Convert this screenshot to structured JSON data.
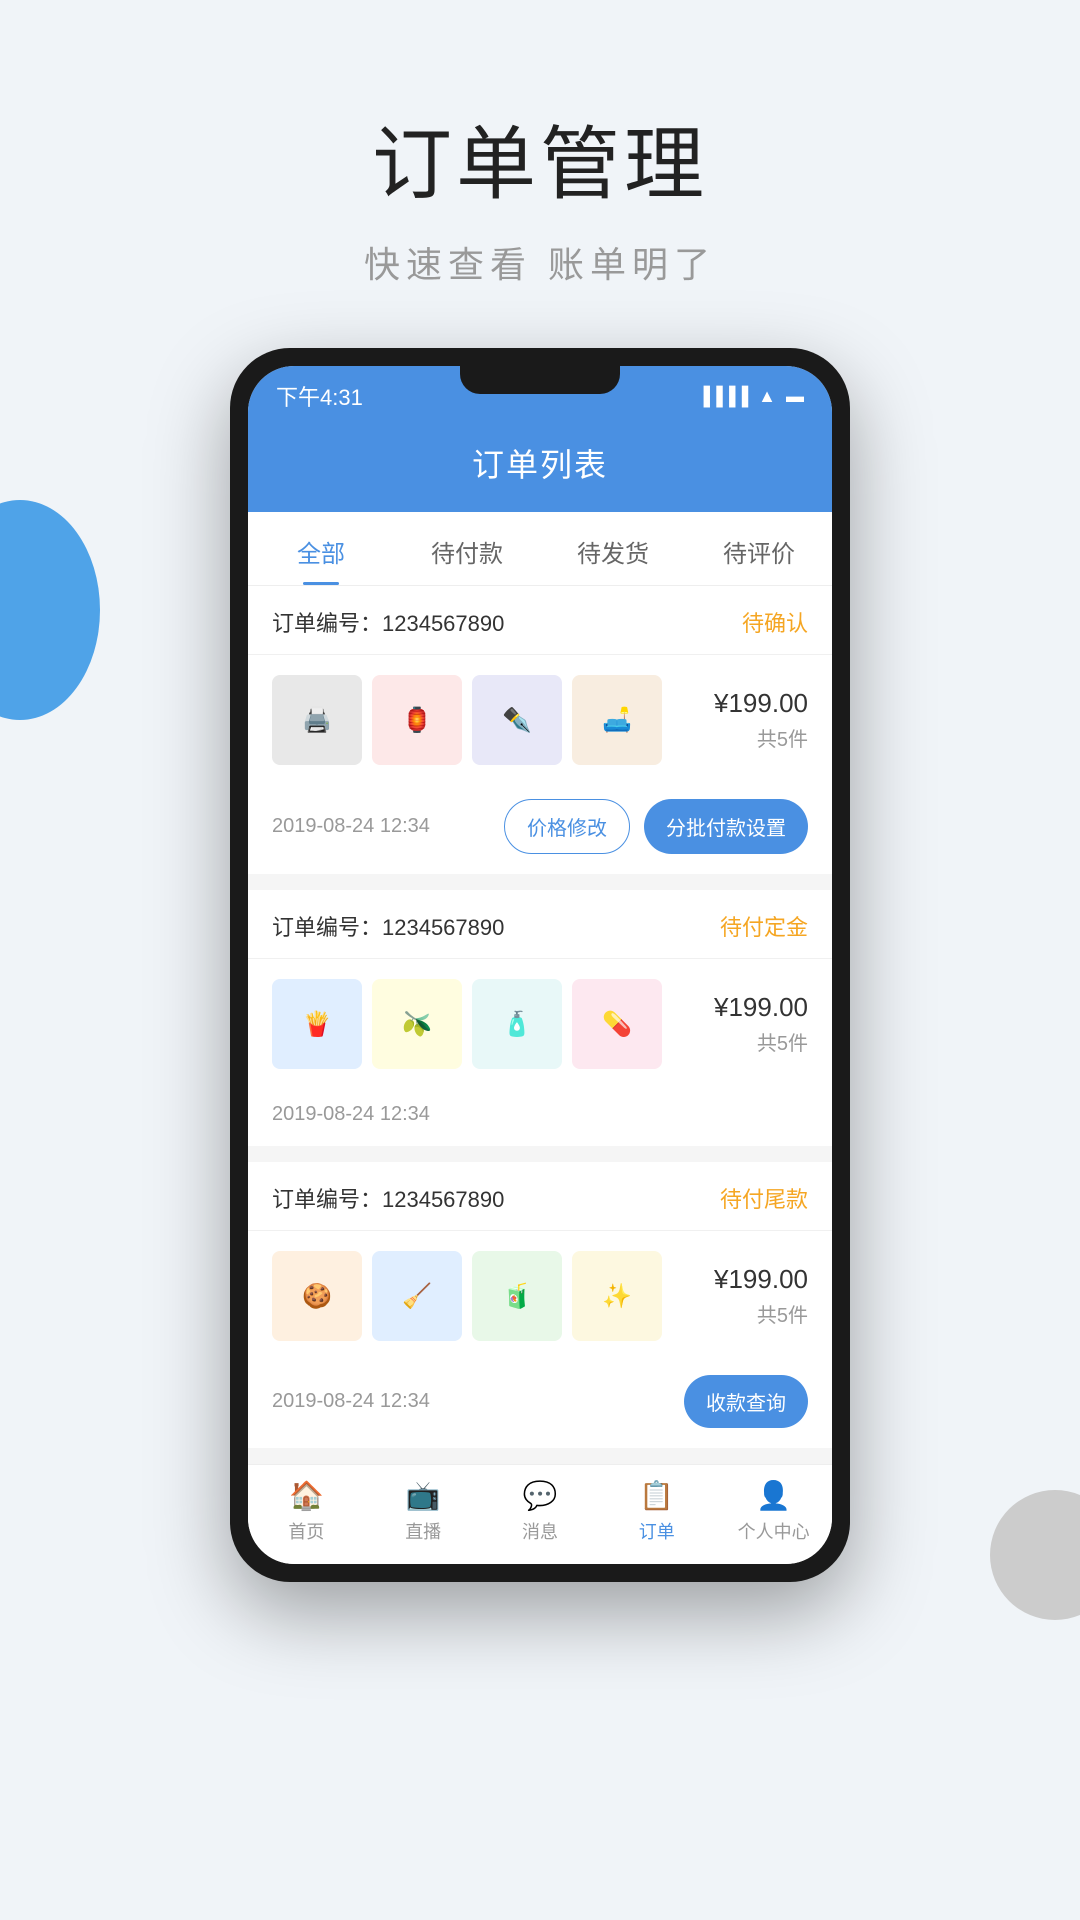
{
  "hero": {
    "title": "订单管理",
    "subtitle": "快速查看  账单明了"
  },
  "phone": {
    "statusBar": {
      "time": "下午4:31",
      "signalIcon": "signal",
      "wifiIcon": "wifi",
      "batteryIcon": "battery"
    },
    "header": {
      "title": "订单列表"
    },
    "tabs": [
      {
        "label": "全部",
        "active": true
      },
      {
        "label": "待付款",
        "active": false
      },
      {
        "label": "待发货",
        "active": false
      },
      {
        "label": "待评价",
        "active": false
      }
    ],
    "orders": [
      {
        "id": "order-1",
        "number": "订单编号：1234567890",
        "status": "待确认",
        "products": [
          {
            "emoji": "🖨️",
            "class": "img-printer"
          },
          {
            "emoji": "🏮",
            "class": "img-lantern"
          },
          {
            "emoji": "🖊️",
            "class": "img-brush"
          },
          {
            "emoji": "🛏️",
            "class": "img-bed"
          }
        ],
        "price": "¥199.00",
        "count": "共5件",
        "date": "2019-08-24 12:34",
        "actions": [
          {
            "label": "价格修改",
            "type": "outline"
          },
          {
            "label": "分批付款设置",
            "type": "fill"
          }
        ]
      },
      {
        "id": "order-2",
        "number": "订单编号：1234567890",
        "status": "待付定金",
        "products": [
          {
            "emoji": "🍟",
            "class": "img-snack"
          },
          {
            "emoji": "🫒",
            "class": "img-olive"
          },
          {
            "emoji": "🧴",
            "class": "img-sunscreen"
          },
          {
            "emoji": "💊",
            "class": "img-vitamins"
          }
        ],
        "price": "¥199.00",
        "count": "共5件",
        "date": "2019-08-24 12:34",
        "actions": []
      },
      {
        "id": "order-3",
        "number": "订单编号：1234567890",
        "status": "待付尾款",
        "products": [
          {
            "emoji": "🍪",
            "class": "img-cookie"
          },
          {
            "emoji": "🧹",
            "class": "img-cleaner"
          },
          {
            "emoji": "🧃",
            "class": "img-shampoo"
          },
          {
            "emoji": "✨",
            "class": "img-serum"
          }
        ],
        "price": "¥199.00",
        "count": "共5件",
        "date": "2019-08-24 12:34",
        "actions": [
          {
            "label": "收款查询",
            "type": "fill"
          }
        ]
      }
    ],
    "bottomNav": [
      {
        "label": "首页",
        "icon": "🏠",
        "active": false
      },
      {
        "label": "直播",
        "icon": "📺",
        "active": false
      },
      {
        "label": "消息",
        "icon": "💬",
        "active": false
      },
      {
        "label": "订单",
        "icon": "📋",
        "active": true
      },
      {
        "label": "个人中心",
        "icon": "👤",
        "active": false
      }
    ]
  }
}
